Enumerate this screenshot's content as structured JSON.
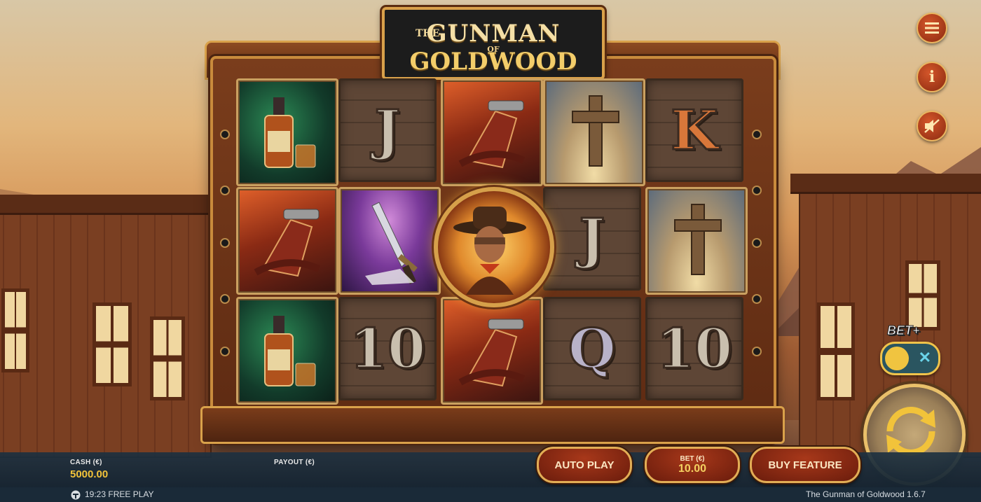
{
  "game": {
    "title_the": "THE",
    "title_line1": "GUNMAN",
    "title_of": "OF",
    "title_line2": "GOLDWOOD"
  },
  "reels": [
    [
      "whiskey-bottle",
      "holster-gun",
      "whiskey-bottle"
    ],
    [
      "J",
      "dagger",
      "10"
    ],
    [
      "holster-gun",
      "gunman-wild",
      "holster-gun"
    ],
    [
      "grave-cross",
      "J",
      "Q"
    ],
    [
      "K",
      "grave-cross",
      "10"
    ]
  ],
  "labels": {
    "J": "J",
    "K": "K",
    "Q": "Q",
    "ten": "10"
  },
  "side_buttons": {
    "menu_icon": "hamburger-menu-icon",
    "info_icon": "info-icon",
    "sound_icon": "sound-muted-icon",
    "info_glyph": "i"
  },
  "bet_plus": {
    "label": "BET+",
    "toggle_symbol": "✕",
    "enabled": false
  },
  "footer": {
    "cash_label": "CASH (€)",
    "cash_value": "5000.00",
    "payout_label": "PAYOUT (€)",
    "payout_value": "",
    "auto_play": "AUTO PLAY",
    "bet_label": "BET (€)",
    "bet_value": "10.00",
    "buy_feature": "BUY FEATURE"
  },
  "status_bar": {
    "clock_mode": "19:23 FREE PLAY",
    "version": "The Gunman of Goldwood  1.6.7"
  },
  "colors": {
    "accent_gold": "#f2c33a",
    "button_red": "#a8381a",
    "toggle_bg": "#2a5560"
  }
}
